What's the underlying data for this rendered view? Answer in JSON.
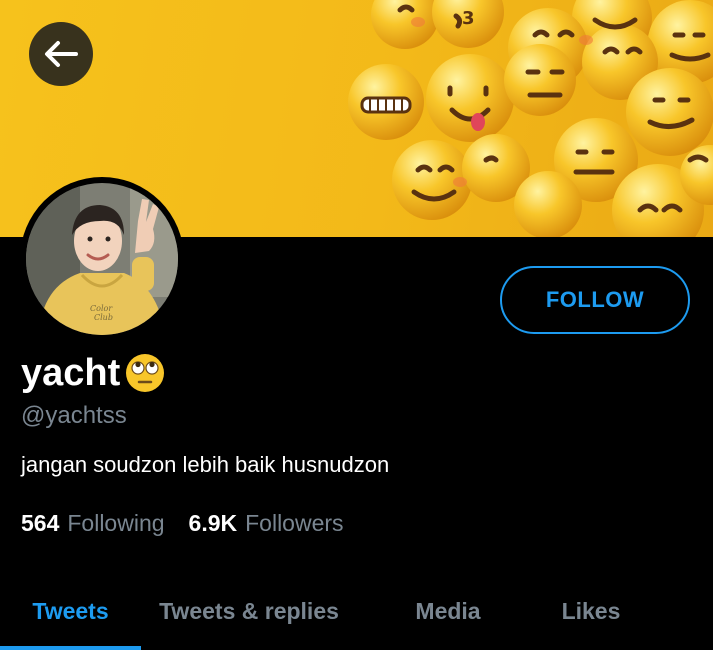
{
  "profile": {
    "display_name": "yacht",
    "name_emoji": "face-with-rolling-eyes",
    "handle": "@yachtss",
    "bio": "jangan soudzon lebih baik husnudzon"
  },
  "header": {
    "back_icon": "arrow-left-icon",
    "follow_label": "FOLLOW"
  },
  "stats": {
    "following_count": "564",
    "following_label": "Following",
    "followers_count": "6.9K",
    "followers_label": "Followers"
  },
  "tabs": [
    {
      "label": "Tweets",
      "active": true
    },
    {
      "label": "Tweets & replies",
      "active": false
    },
    {
      "label": "Media",
      "active": false
    },
    {
      "label": "Likes",
      "active": false
    }
  ],
  "colors": {
    "accent": "#1d9bf0",
    "muted": "#7a8691",
    "background": "#000000",
    "banner": "#f6c21c"
  }
}
